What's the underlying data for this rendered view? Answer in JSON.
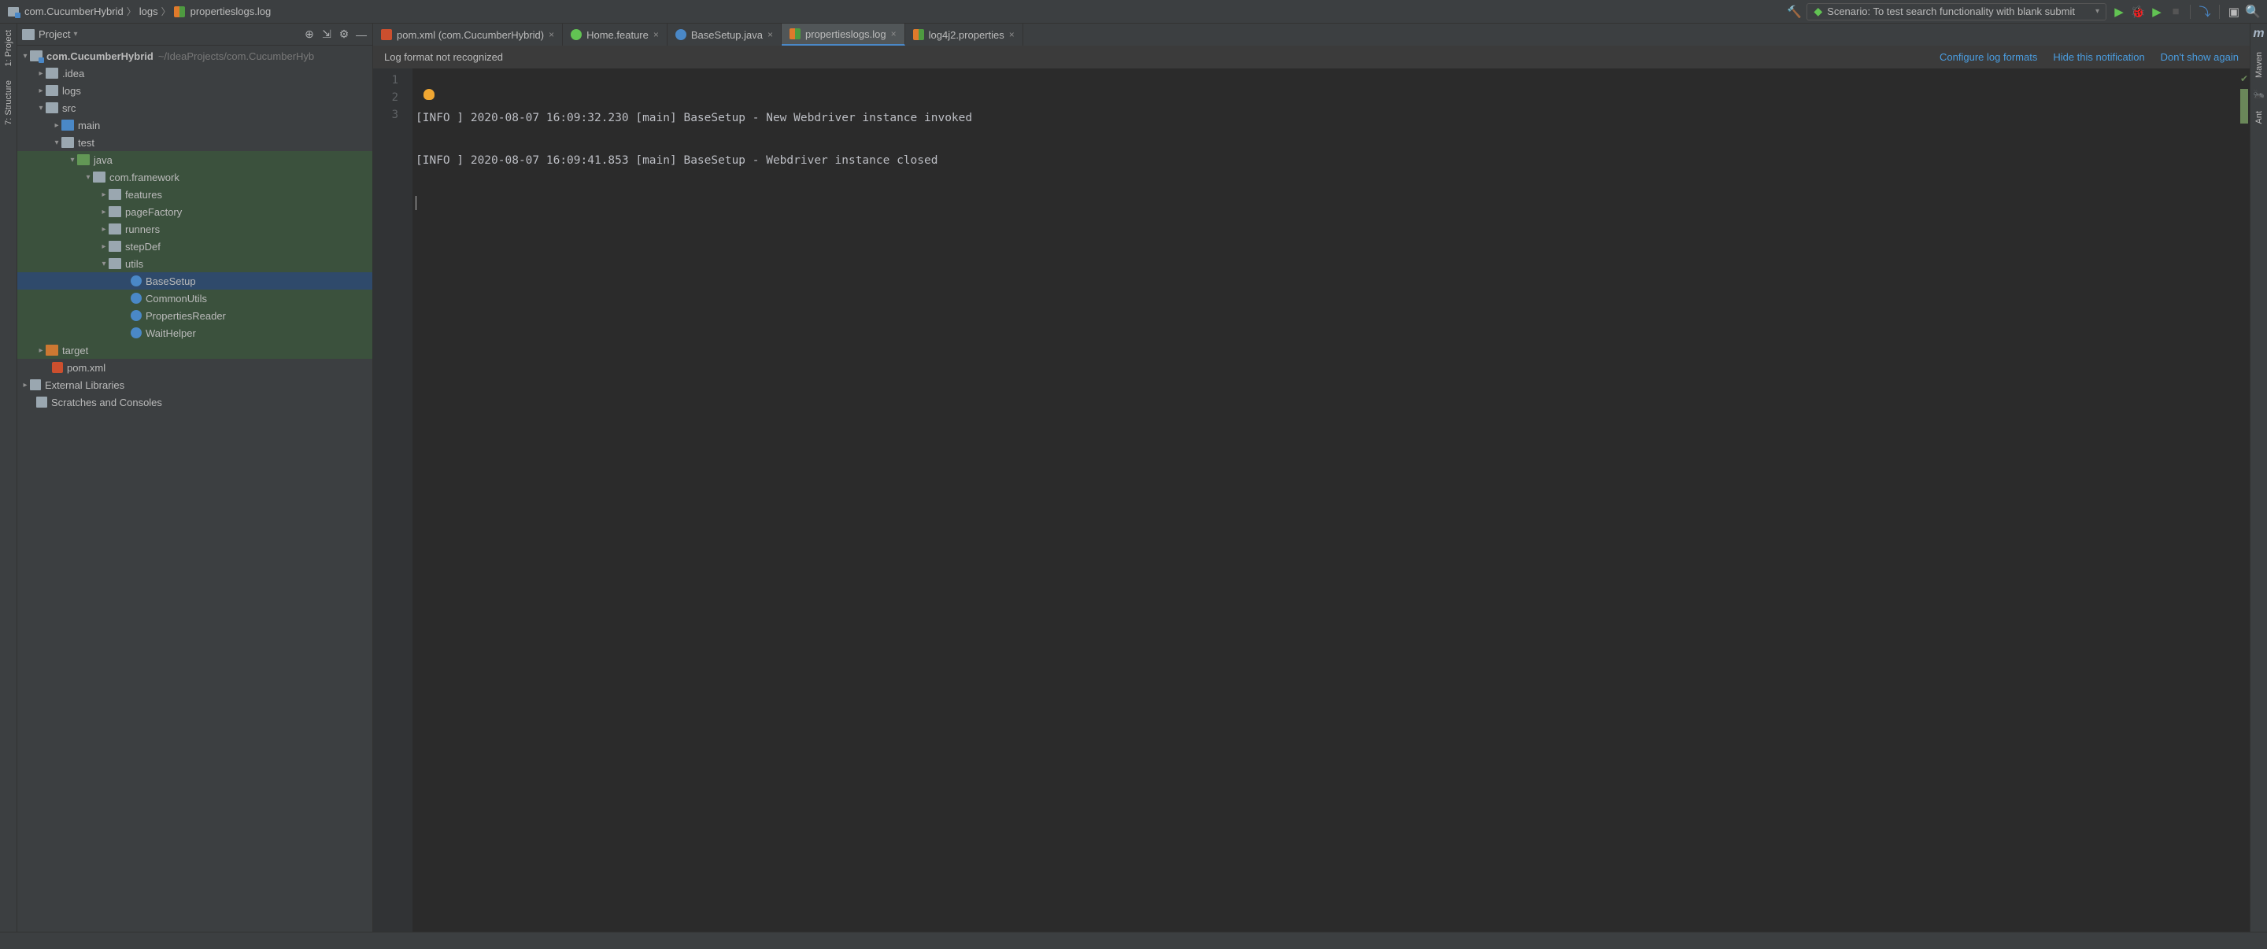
{
  "breadcrumb": {
    "root": "com.CucumberHybrid",
    "mid": "logs",
    "file": "propertieslogs.log"
  },
  "runconfig": {
    "label": "Scenario: To test search functionality with blank submit"
  },
  "tree": {
    "title": "Project",
    "root": "com.CucumberHybrid",
    "root_path": "~/IdeaProjects/com.CucumberHyb",
    "idea": ".idea",
    "logs": "logs",
    "src": "src",
    "main": "main",
    "test": "test",
    "java": "java",
    "pkg": "com.framework",
    "features": "features",
    "pagefactory": "pageFactory",
    "runners": "runners",
    "stepdef": "stepDef",
    "utils": "utils",
    "basesetup": "BaseSetup",
    "commonutils": "CommonUtils",
    "propreader": "PropertiesReader",
    "waithelper": "WaitHelper",
    "target": "target",
    "pomxml": "pom.xml",
    "extlib": "External Libraries",
    "scratches": "Scratches and Consoles"
  },
  "tabs": {
    "pom": "pom.xml (com.CucumberHybrid)",
    "home": "Home.feature",
    "base": "BaseSetup.java",
    "proplog": "propertieslogs.log",
    "log4j": "log4j2.properties"
  },
  "notif": {
    "msg": "Log format not recognized",
    "link1": "Configure log formats",
    "link2": "Hide this notification",
    "link3": "Don't show again"
  },
  "code": {
    "l1": "[INFO ] 2020-08-07 16:09:32.230 [main] BaseSetup - New Webdriver instance invoked",
    "l2": "[INFO ] 2020-08-07 16:09:41.853 [main] BaseSetup - Webdriver instance closed",
    "l3": ""
  },
  "gutter": {
    "n1": "1",
    "n2": "2",
    "n3": "3"
  },
  "leftstrip": {
    "project": "1: Project",
    "structure": "7: Structure"
  },
  "rightstrip": {
    "maven": "Maven",
    "ant": "Ant"
  }
}
